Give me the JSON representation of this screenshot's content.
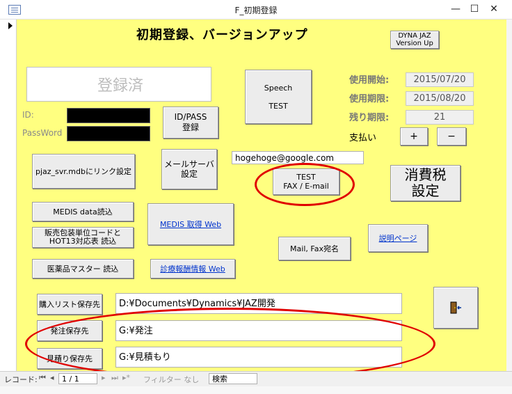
{
  "window": {
    "title": "F_初期登録",
    "minimize": "—",
    "maximize": "☐",
    "close": "✕"
  },
  "form": {
    "heading": "初期登録、バージョンアップ",
    "dyna_jaz_button": "DYNA JAZ\nVersion Up",
    "registered_status": "登録済",
    "id_label": "ID:",
    "password_label": "PassWord",
    "id_pass_button": "ID/PASS\n登録",
    "speech_test_button": "Speech\n\nTEST",
    "usage_start_label": "使用開始:",
    "usage_start_value": "2015/07/20",
    "usage_end_label": "使用期限:",
    "usage_end_value": "2015/08/20",
    "remaining_label": "残り期限:",
    "remaining_value": "21",
    "payment_label": "支払い",
    "plus_button": "+",
    "minus_button": "−",
    "email_value": "hogehoge@google.com",
    "pjaz_link_button": "pjaz_svr.mdbにリンク設定",
    "mail_server_button": "メールサーバ\n設定",
    "test_fax_button": "TEST\nFAX / E-mail",
    "tax_setting_button": "消費税\n設定",
    "medis_data_button": "MEDIS data読込",
    "medis_web_link": "MEDIS 取得 Web",
    "hot13_button": "販売包装単位コードと\nHOT13対応表 読込",
    "explain_link": "説明ページ",
    "mail_fax_button": "Mail, Fax宛名",
    "drug_master_button": "医薬品マスター 読込",
    "fee_info_link": "診療報酬情報 Web",
    "purchase_save_button": "購入リスト保存先",
    "purchase_save_value": "D:¥Documents¥Dynamics¥JAZ開発",
    "order_save_button": "発注保存先",
    "order_save_value": "G:¥発注",
    "estimate_save_button": "見積り保存先",
    "estimate_save_value": "G:¥見積もり"
  },
  "navbar": {
    "record_label": "レコード:",
    "record_value": "1 / 1",
    "filter_label": "フィルター なし",
    "search_placeholder": "検索"
  },
  "colors": {
    "form_bg": "#ffff80",
    "annotation": "#e00000",
    "link": "#0033cc"
  }
}
